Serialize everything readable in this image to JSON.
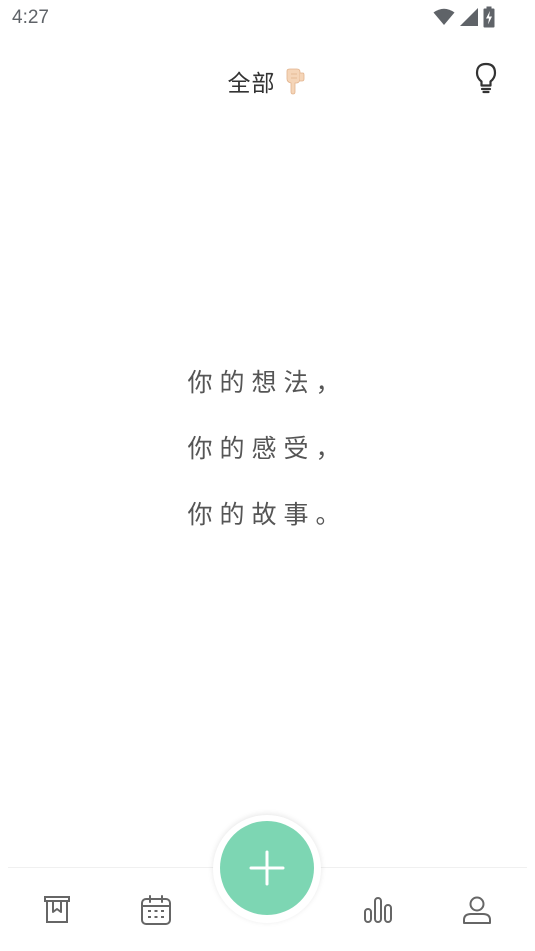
{
  "status_bar": {
    "time": "4:27",
    "icons": [
      "wifi-icon",
      "signal-icon",
      "battery-charging-icon"
    ]
  },
  "header": {
    "title": "全部",
    "title_icon": "pointing-down-hand-icon",
    "right_icon": "lightbulb-icon"
  },
  "quote": {
    "lines": [
      "你的想法，",
      "你的感受，",
      "你的故事。"
    ]
  },
  "bottom_nav": {
    "items": [
      {
        "icon": "archive-box-icon"
      },
      {
        "icon": "calendar-icon"
      },
      {
        "icon": "bar-chart-icon"
      },
      {
        "icon": "profile-icon"
      }
    ],
    "fab_icon": "plus-icon"
  },
  "colors": {
    "accent": "#7dd6b3",
    "text": "#333333",
    "quote_text": "#555555",
    "icon": "#666666"
  }
}
